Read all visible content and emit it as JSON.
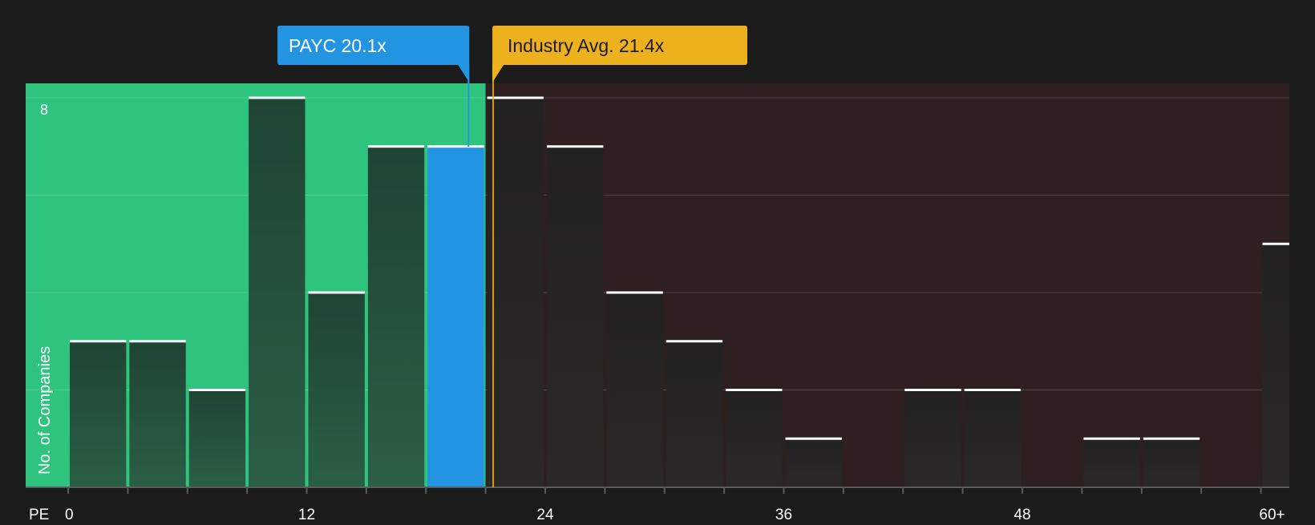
{
  "colors": {
    "background": "#1b1b1c",
    "undervalued_zone": "#2ec47d",
    "overvalued_zone": "#2e1f20",
    "bar_under": "#234a37",
    "bar_over": "#262424",
    "highlight_bar": "#2394e2",
    "company_marker": "#2394e2",
    "industry_marker": "#eeb11e",
    "bar_cap": "#ffffff"
  },
  "markers": {
    "company_label": "PAYC 20.1x",
    "company_value": 20.1,
    "industry_label": "Industry Avg. 21.4x",
    "industry_value": 21.4
  },
  "chart_data": {
    "type": "bar",
    "title": "",
    "xlabel": "PE",
    "ylabel": "No. of Companies",
    "xlim": [
      0,
      60
    ],
    "ylim": [
      0,
      8
    ],
    "x_ticks": [
      0,
      12,
      24,
      36,
      48,
      60
    ],
    "x_tick_labels": [
      "0",
      "12",
      "24",
      "36",
      "48",
      "60+"
    ],
    "y_tick_labels": [
      {
        "value": 8,
        "label": "8"
      }
    ],
    "gridlines_y": [
      2,
      4,
      6,
      8
    ],
    "bin_width": 3,
    "bins": [
      {
        "start": 0,
        "end": 3,
        "count": 3
      },
      {
        "start": 3,
        "end": 6,
        "count": 3
      },
      {
        "start": 6,
        "end": 9,
        "count": 2
      },
      {
        "start": 9,
        "end": 12,
        "count": 8
      },
      {
        "start": 12,
        "end": 15,
        "count": 4
      },
      {
        "start": 15,
        "end": 18,
        "count": 7
      },
      {
        "start": 18,
        "end": 21,
        "count": 7,
        "highlight": true
      },
      {
        "start": 21,
        "end": 24,
        "count": 8
      },
      {
        "start": 24,
        "end": 27,
        "count": 7
      },
      {
        "start": 27,
        "end": 30,
        "count": 4
      },
      {
        "start": 30,
        "end": 33,
        "count": 3
      },
      {
        "start": 33,
        "end": 36,
        "count": 2
      },
      {
        "start": 36,
        "end": 39,
        "count": 1
      },
      {
        "start": 39,
        "end": 42,
        "count": 0
      },
      {
        "start": 42,
        "end": 45,
        "count": 2
      },
      {
        "start": 45,
        "end": 48,
        "count": 2
      },
      {
        "start": 48,
        "end": 51,
        "count": 0
      },
      {
        "start": 51,
        "end": 54,
        "count": 1
      },
      {
        "start": 54,
        "end": 57,
        "count": 1
      },
      {
        "start": 57,
        "end": 60,
        "count": 0
      },
      {
        "start": 60,
        "end": 61.5,
        "count": 5,
        "overflow": true
      }
    ]
  }
}
